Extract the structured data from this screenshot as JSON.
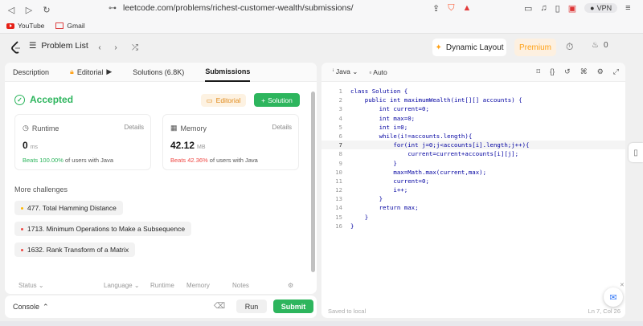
{
  "browser": {
    "url": "leetcode.com/problems/richest-customer-wealth/submissions/",
    "bookmarks": [
      "YouTube",
      "Gmail"
    ],
    "vpn_label": "VPN"
  },
  "lc_nav": {
    "problem_list": "Problem List",
    "dynamic_layout": "Dynamic Layout",
    "premium": "Premium",
    "streak": "0"
  },
  "left": {
    "tabs": [
      {
        "label": "Description"
      },
      {
        "label": "Editorial"
      },
      {
        "label": "Solutions (6.8K)"
      },
      {
        "label": "Submissions"
      }
    ],
    "status": "Accepted",
    "editorial_btn": "Editorial",
    "solution_btn": "Solution",
    "runtime": {
      "label": "Runtime",
      "details": "Details",
      "value": "0",
      "unit": "ms",
      "beats_pct": "Beats 100.00%",
      "beats_rest": "of users with Java"
    },
    "memory": {
      "label": "Memory",
      "details": "Details",
      "value": "42.12",
      "unit": "MB",
      "beats_pct": "Beats 42.36%",
      "beats_rest": "of users with Java"
    },
    "more_title": "More challenges",
    "challenges": [
      {
        "title": "477. Total Hamming Distance",
        "color": "#ffb800"
      },
      {
        "title": "1713. Minimum Operations to Make a Subsequence",
        "color": "#ef4743"
      },
      {
        "title": "1632. Rank Transform of a Matrix",
        "color": "#ef4743"
      }
    ],
    "columns": [
      "Status",
      "Language",
      "Runtime",
      "Memory",
      "Notes"
    ]
  },
  "console": {
    "label": "Console",
    "run": "Run",
    "submit": "Submit"
  },
  "editor": {
    "language": "Java",
    "mode": "Auto",
    "saved": "Saved to local",
    "cursor": "Ln 7, Col 26",
    "current_line": 7,
    "lines": [
      "class Solution {",
      "    public int maximumWealth(int[][] accounts) {",
      "        int current=0;",
      "        int max=0;",
      "        int i=0;",
      "        while(i!=accounts.length){",
      "            for(int j=0;j<accounts[i].length;j++){",
      "                current=current+accounts[i][j];",
      "            }",
      "            max=Math.max(current,max);",
      "            current=0;",
      "            i++;",
      "        }",
      "        return max;",
      "    }",
      "}"
    ]
  }
}
